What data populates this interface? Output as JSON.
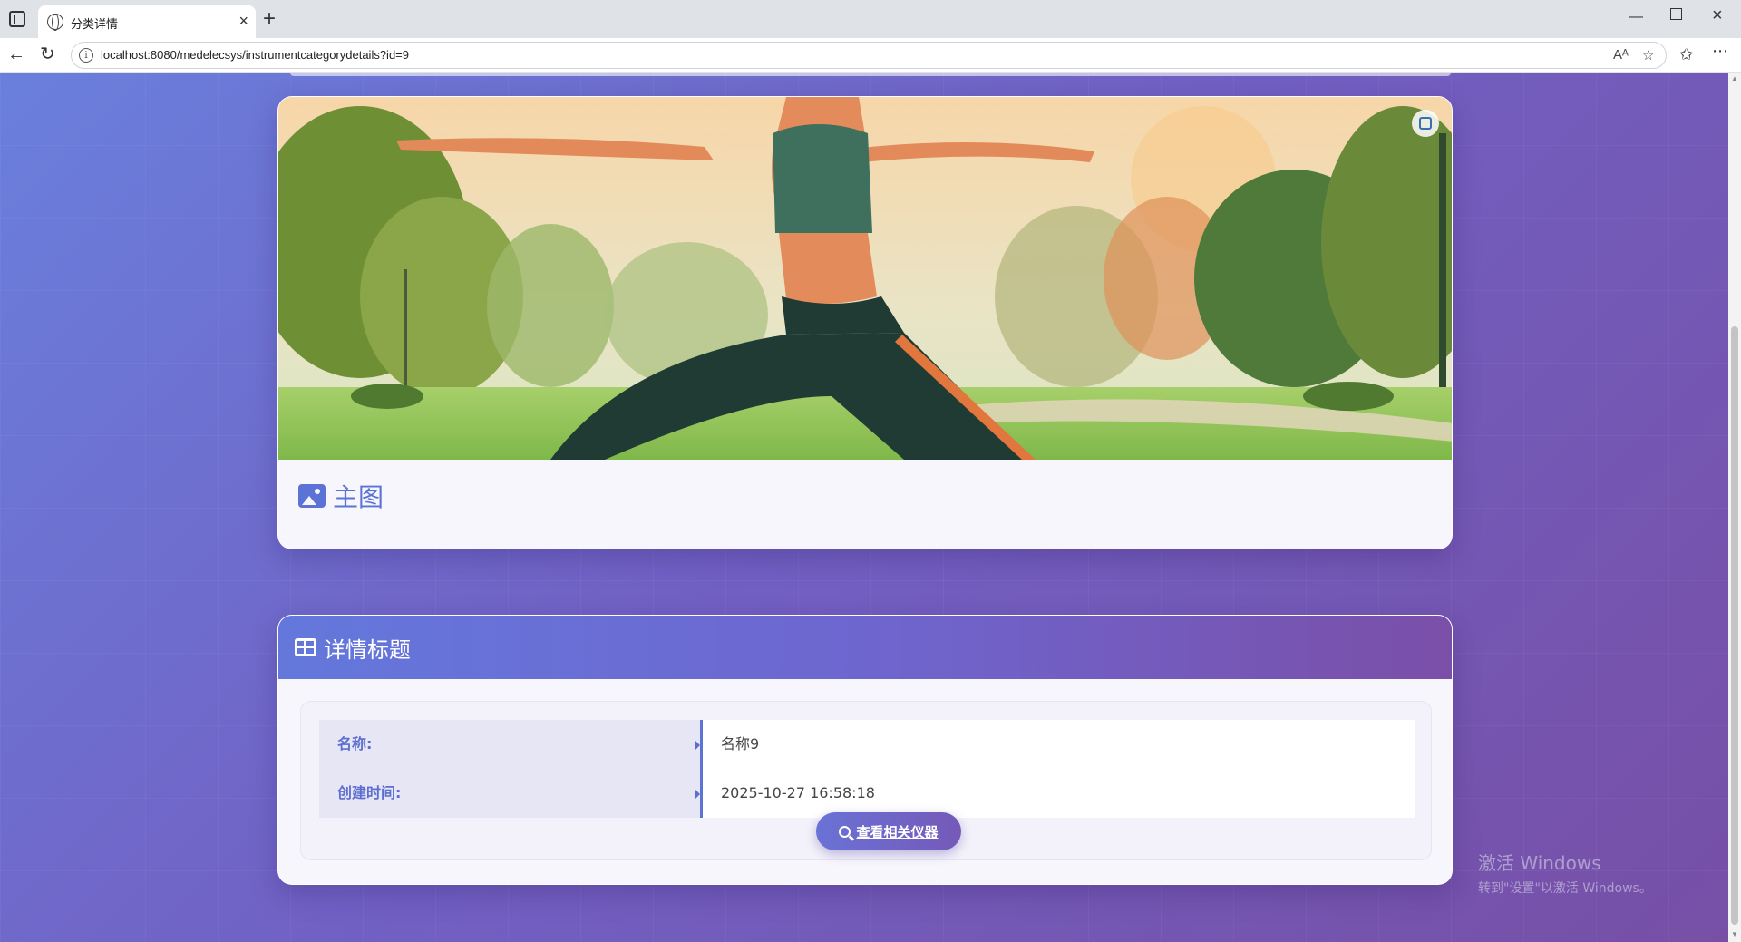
{
  "browser": {
    "tab_title": "分类详情",
    "url": "localhost:8080/medelecsys/instrumentcategorydetails?id=9",
    "reader_label": "Aᴬ"
  },
  "image_card": {
    "caption": "主图"
  },
  "details": {
    "header_title": "详情标题",
    "rows": [
      {
        "label": "名称:",
        "value": "名称9"
      },
      {
        "label": "创建时间:",
        "value": "2025-10-27 16:58:18"
      }
    ],
    "button_label": "查看相关仪器"
  },
  "watermark": {
    "line1": "激活 Windows",
    "line2": "转到\"设置\"以激活 Windows。"
  },
  "colors": {
    "accent": "#5b72d6",
    "gradient_start": "#6a7fdc",
    "gradient_end": "#774fa6"
  }
}
